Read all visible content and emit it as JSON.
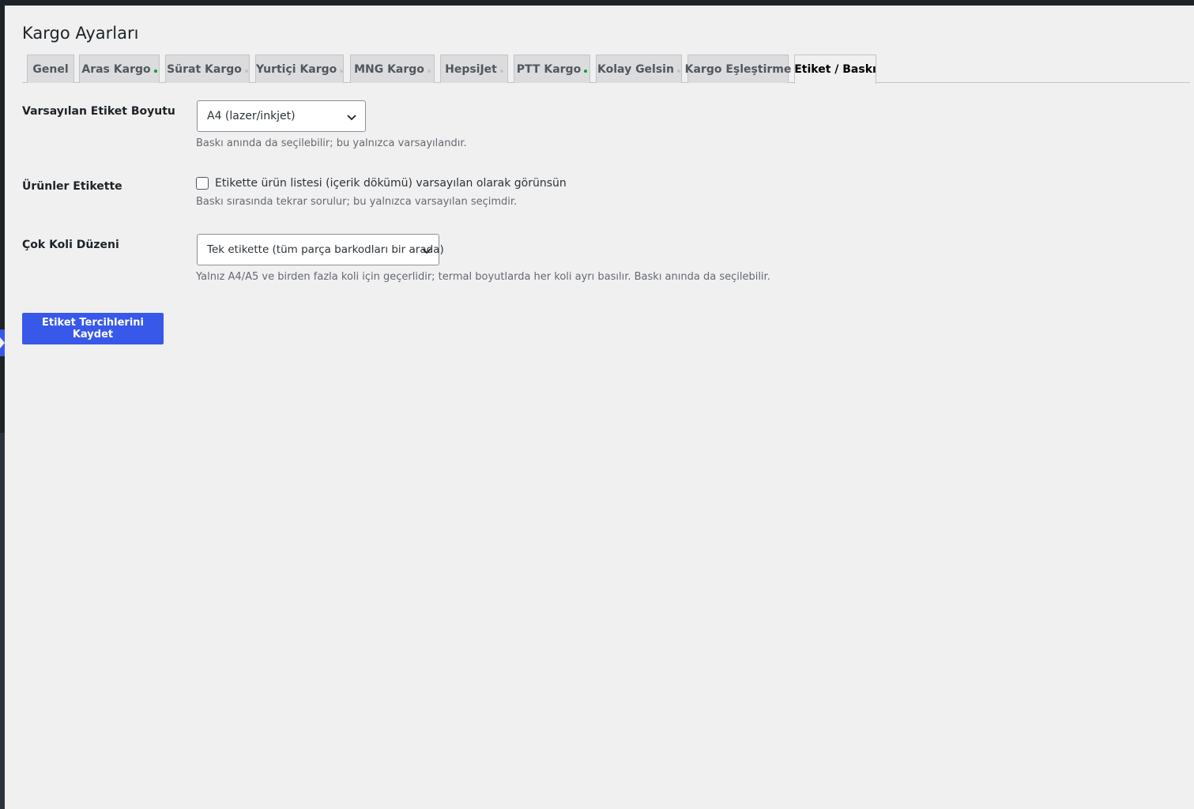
{
  "page": {
    "title": "Kargo Ayarları"
  },
  "tabs": [
    {
      "label": "Genel",
      "status": "none"
    },
    {
      "label": "Aras Kargo",
      "status": "green"
    },
    {
      "label": "Sürat Kargo",
      "status": "grey"
    },
    {
      "label": "Yurtiçi Kargo",
      "status": "grey"
    },
    {
      "label": "MNG Kargo",
      "status": "grey"
    },
    {
      "label": "HepsiJet",
      "status": "grey"
    },
    {
      "label": "PTT Kargo",
      "status": "green"
    },
    {
      "label": "Kolay Gelsin",
      "status": "grey"
    },
    {
      "label": "Kargo Eşleştirme",
      "status": "none"
    },
    {
      "label": "Etiket / Baskı",
      "status": "active"
    }
  ],
  "form": {
    "label_size": {
      "label": "Varsayılan Etiket Boyutu",
      "selected": "A4 (lazer/inkjet)",
      "description": "Baskı anında da seçilebilir; bu yalnızca varsayılandır."
    },
    "products_on_label": {
      "label": "Ürünler Etikette",
      "checkbox_label": "Etikette ürün listesi (içerik dökümü) varsayılan olarak görünsün",
      "checked": false,
      "description": "Baskı sırasında tekrar sorulur; bu yalnızca varsayılan seçimdir."
    },
    "multi_parcel_layout": {
      "label": "Çok Koli Düzeni",
      "selected": "Tek etikette (tüm parça barkodları bir arada)",
      "description": "Yalnız A4/A5 ve birden fazla koli için geçerlidir; termal boyutlarda her koli ayrı basılır. Baskı anında da seçilebilir."
    }
  },
  "actions": {
    "save_label": "Etiket Tercihlerini Kaydet"
  },
  "colors": {
    "accent": "#3858e9",
    "status_green": "#00a32a",
    "status_grey": "#c3c4c7"
  }
}
